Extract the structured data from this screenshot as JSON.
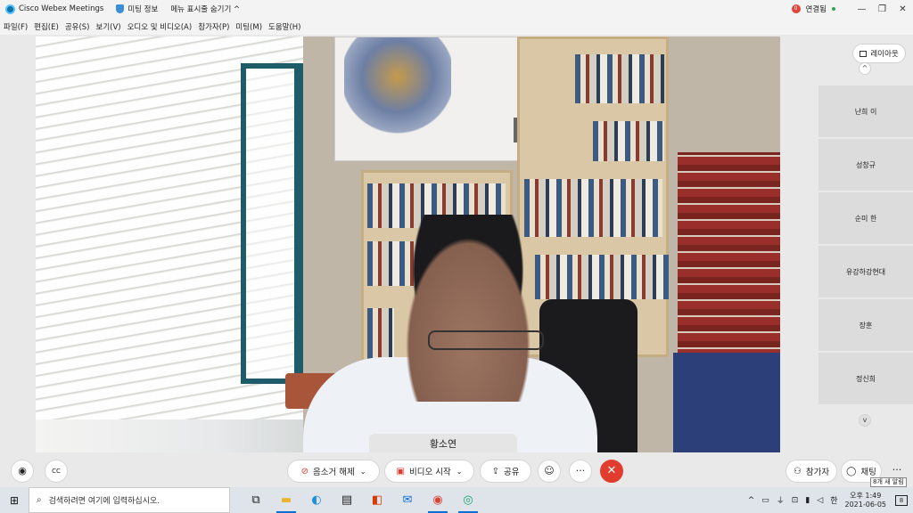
{
  "titlebar": {
    "app_name": "Cisco Webex Meetings",
    "meeting_info": "미팅 정보",
    "hide_menu": "메뉴 표시줄 숨기기 ^",
    "connection_badge": "0",
    "connection_label": "연결됨",
    "minimize": "—",
    "restore": "❐",
    "close": "✕"
  },
  "menubar": {
    "items": [
      "파일(F)",
      "편집(E)",
      "공유(S)",
      "보기(V)",
      "오디오 및 비디오(A)",
      "참가자(P)",
      "미팅(M)",
      "도움말(H)"
    ]
  },
  "video": {
    "speaker_name": "황소연"
  },
  "sidebar": {
    "layout_label": "레이아웃",
    "participants": [
      "난희 이",
      "성창규",
      "순미 한",
      "유강하강현대",
      "장훈",
      "정신희"
    ]
  },
  "controls": {
    "mute_label": "음소거 해제",
    "video_label": "비디오 시작",
    "share_label": "공유",
    "reactions": "☺",
    "more": "···",
    "end": "✕",
    "participants_label": "참가자",
    "chat_label": "채팅",
    "more_right": "···",
    "cc": "CC"
  },
  "notification_toast": "8개 새 알림",
  "taskbar": {
    "search_placeholder": "검색하려면 여기에 입력하십시오.",
    "time_period": "오후 1:49",
    "date": "2021-06-05",
    "lang": "한",
    "notify_count": "8"
  },
  "colors": {
    "end_call": "#e23c2f",
    "connection_dot": "#e0443a",
    "accent": "#0b6fd3"
  }
}
